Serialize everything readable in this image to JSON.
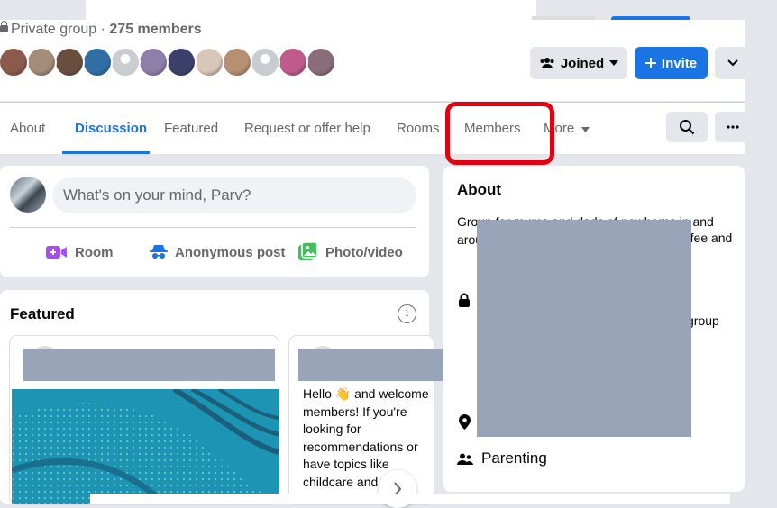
{
  "header": {
    "privacy_label": "Private group · ",
    "member_count": "275 members",
    "joined_button": "Joined",
    "invite_button": "Invite"
  },
  "member_avatars": [
    "#8b5a4a",
    "#a38c78",
    "#6a4f3e",
    "#2f6fa6",
    "#c9cdd2",
    "#8d7fa8",
    "#3b3f6a",
    "#d8c6b8",
    "#b88f73",
    "#c9cdd2",
    "#c05a8c",
    "#8a6d7a"
  ],
  "tabs": [
    "About",
    "Discussion",
    "Featured",
    "Request or offer help",
    "Rooms",
    "Members",
    "More"
  ],
  "composer": {
    "placeholder": "What's on your mind, Parv?",
    "actions": [
      "Room",
      "Anonymous post",
      "Photo/video"
    ]
  },
  "featured": {
    "title": "Featured",
    "info": "i",
    "card2_text": "Hello 👋 and welcome members! If you're looking for recommendations or have topics like childcare and think might have been previously, we have"
  },
  "about": {
    "title": "About",
    "description": "Group for mums and dads of newborns in and around ... coffee and chat ... SCO",
    "side_line_1": "ffee and",
    "side_line_2": "group",
    "category": "Parenting"
  },
  "colors": {
    "accent": "#1b74e4",
    "highlight": "#e4000f",
    "redaction": "#98a4b8"
  }
}
